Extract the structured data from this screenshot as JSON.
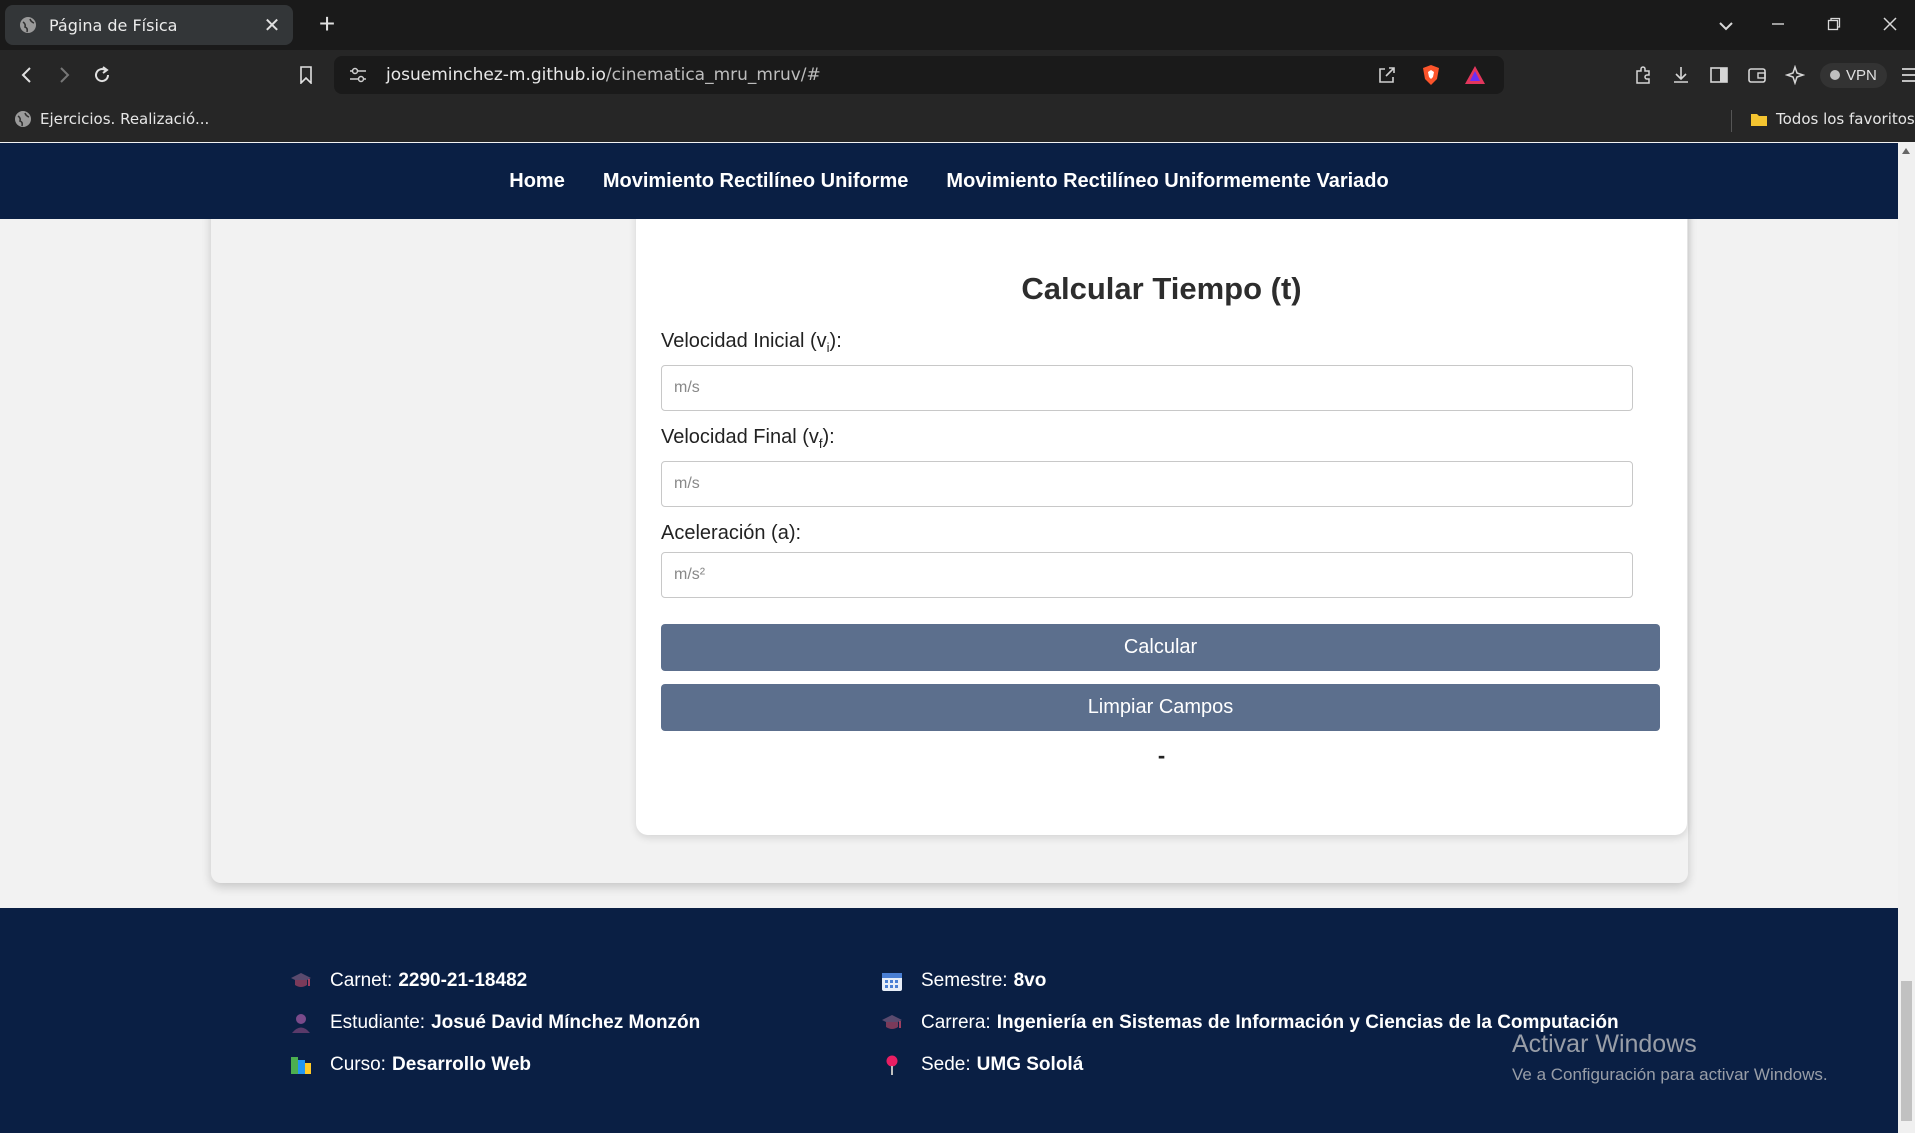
{
  "browser": {
    "tab_title": "Página de Física",
    "tab_close": "✕",
    "new_tab": "+",
    "url_host": "josueminchez-m.github.io",
    "url_path": "/cinematica_mru_mruv/#",
    "vpn_label": "VPN",
    "bookmarks": {
      "left_item": "Ejercicios. Realizació...",
      "right_item": "Todos los favoritos"
    }
  },
  "nav": {
    "items": [
      "Home",
      "Movimiento Rectilíneo Uniforme",
      "Movimiento Rectilíneo Uniformemente Variado"
    ]
  },
  "calculator": {
    "top_result": "-",
    "title": "Calcular Tiempo (t)",
    "fields": [
      {
        "label": "Velocidad Inicial (v",
        "sub": "i",
        "suffix": "):",
        "placeholder": "m/s"
      },
      {
        "label": "Velocidad Final (v",
        "sub": "f",
        "suffix": "):",
        "placeholder": "m/s"
      },
      {
        "label": "Aceleración (a):",
        "sub": "",
        "suffix": "",
        "placeholder": "m/s²"
      }
    ],
    "calculate_label": "Calcular",
    "clear_label": "Limpiar Campos",
    "result": "-"
  },
  "footer": {
    "carnet": {
      "label": "Carnet:",
      "value": "2290-21-18482",
      "icon": "graduation-cap-icon"
    },
    "estudiante": {
      "label": "Estudiante:",
      "value": "Josué David Mínchez Monzón",
      "icon": "person-icon"
    },
    "curso": {
      "label": "Curso:",
      "value": "Desarrollo Web",
      "icon": "books-icon"
    },
    "semestre": {
      "label": "Semestre:",
      "value": "8vo",
      "icon": "calendar-icon"
    },
    "carrera": {
      "label": "Carrera:",
      "value": "Ingeniería en Sistemas de Información y Ciencias de la Computación",
      "icon": "graduation-cap-icon"
    },
    "sede": {
      "label": "Sede:",
      "value": "UMG Sololá",
      "icon": "map-pin-icon"
    }
  },
  "watermark": {
    "line1": "Activar Windows",
    "line2": "Ve a Configuración para activar Windows."
  },
  "colors": {
    "nav_bg": "#0a1f44",
    "button_bg": "#5c6f8d",
    "page_bg": "#f2f2f2"
  }
}
